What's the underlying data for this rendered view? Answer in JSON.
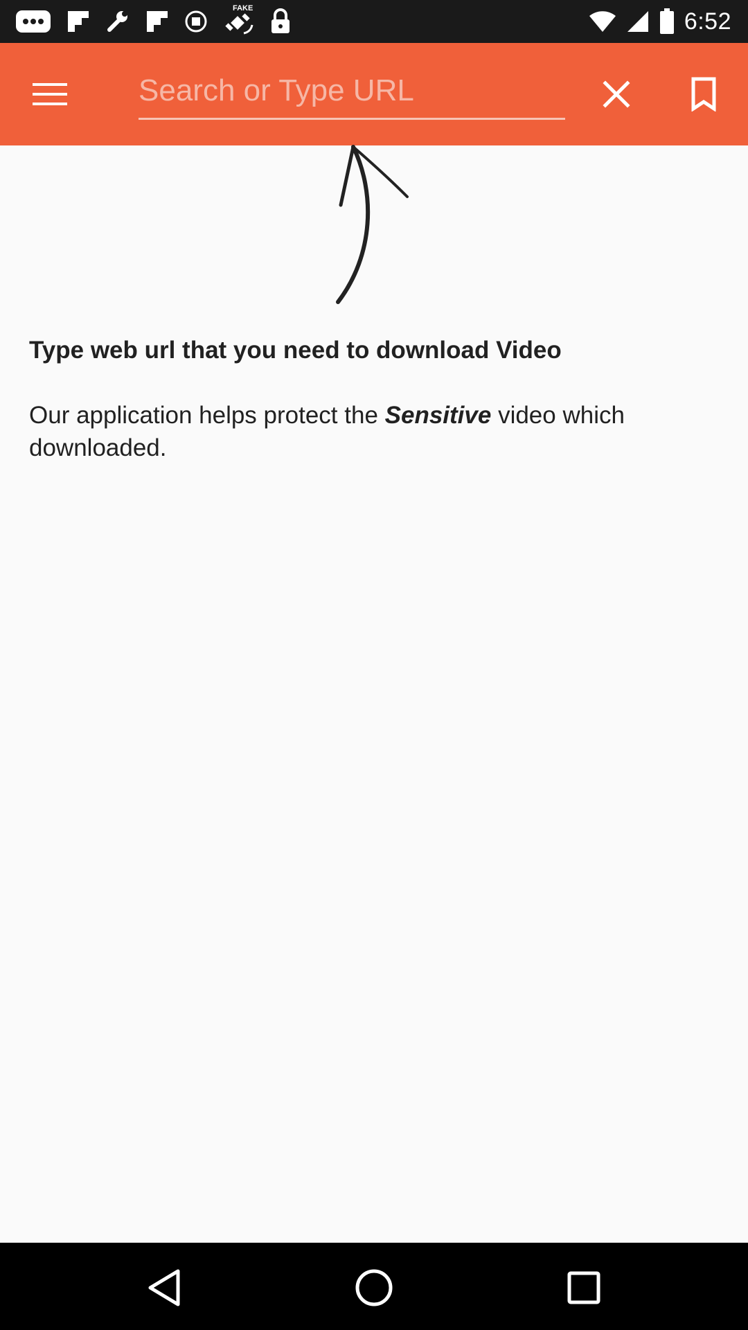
{
  "status_bar": {
    "time": "6:52",
    "icons": [
      "more-notifications-icon",
      "flipboard-icon",
      "wrench-icon",
      "flipboard-icon",
      "media-stop-icon",
      "fake-gps-satellite-icon",
      "lock-icon",
      "wifi-icon",
      "signal-icon",
      "battery-icon"
    ],
    "fake_gps_badge": "FAKE"
  },
  "app_bar": {
    "background": "#f0603a",
    "menu_icon": "hamburger-menu-icon",
    "search": {
      "placeholder": "Search or Type URL",
      "value": ""
    },
    "close_icon": "close-icon",
    "bookmark_icon": "bookmark-icon"
  },
  "content": {
    "arrow_icon": "curved-arrow-up-icon",
    "headline": "Type web url that you need to download Video",
    "description_before": "Our application helps protect the ",
    "description_emphasis": "Sensitive",
    "description_after": " video which downloaded."
  },
  "nav_bar": {
    "back_icon": "back-triangle-icon",
    "home_icon": "home-circle-icon",
    "recents_icon": "recents-square-icon"
  }
}
